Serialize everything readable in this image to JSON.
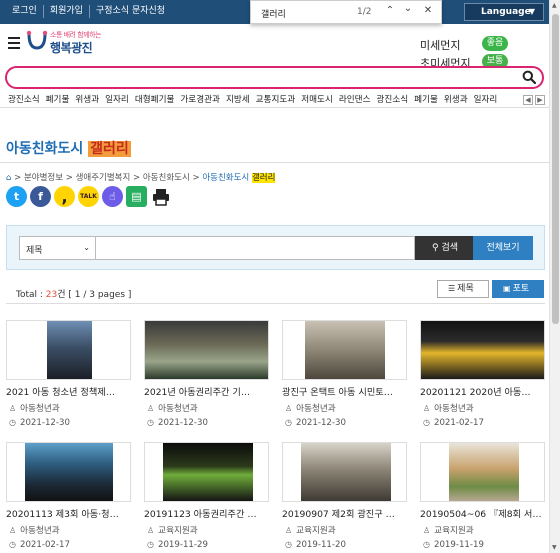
{
  "topbar": {
    "links": [
      "로그인",
      "회원가입",
      "구정소식 문자신청"
    ],
    "language": "Language"
  },
  "findbar": {
    "query": "갤러리",
    "count": "1/2"
  },
  "header": {
    "logo_small": "소통 배려 함께하는",
    "logo_main": "행복광진",
    "dust": [
      {
        "label": "미세먼지",
        "status": "좋음"
      },
      {
        "label": "초미세먼지",
        "status": "보통"
      }
    ]
  },
  "search": {
    "placeholder": ""
  },
  "menu": {
    "items": [
      "광진소식",
      "폐기물",
      "위생과",
      "일자리",
      "대형폐기물",
      "가로경관과",
      "지방세",
      "교통지도과",
      "저매도시",
      "라인댄스",
      "광진소식",
      "폐기물",
      "위생과",
      "일자리"
    ]
  },
  "page": {
    "title_prefix": "아동친화도시",
    "title_highlight": "갤러리",
    "breadcrumb": [
      "분야별정보",
      "생애주기별복지",
      "아동친화도시"
    ],
    "breadcrumb_last_prefix": "아동친화도시",
    "breadcrumb_last_highlight": "갤러리"
  },
  "search_panel": {
    "select_value": "제목",
    "search_label": "검색",
    "all_label": "전체보기"
  },
  "listing": {
    "total_label": "Total :",
    "total_count": "23",
    "total_unit": "건",
    "pages": "[ 1 / 3 pages ]",
    "view_list": "제목",
    "view_photo": "포토"
  },
  "gallery": [
    {
      "title": "2021 아동 청소년 정책제…",
      "dept": "아동청년과",
      "date": "2021-12-30"
    },
    {
      "title": "2021년 아동권리주간 기…",
      "dept": "아동청년과",
      "date": "2021-12-30"
    },
    {
      "title": "광진구 온택트 아동 시민토…",
      "dept": "아동청년과",
      "date": "2021-12-30"
    },
    {
      "title": "20201121 2020년 아동…",
      "dept": "아동청년과",
      "date": "2021-02-17"
    },
    {
      "title": "20201113 제3회 아동·청…",
      "dept": "아동청년과",
      "date": "2021-02-17"
    },
    {
      "title": "20191123 아동권리주간 …",
      "dept": "교육지원과",
      "date": "2019-11-29"
    },
    {
      "title": "20190907 제2회 광진구 …",
      "dept": "교육지원과",
      "date": "2019-11-20"
    },
    {
      "title": "20190504~06 『제8회 서…",
      "dept": "교육지원과",
      "date": "2019-11-19"
    }
  ],
  "colors": {
    "topbar": "#1f4e79",
    "accent": "#2f80c3",
    "search_border": "#d9246f",
    "highlight": "#f39c3c",
    "good": "#3bb54a"
  }
}
